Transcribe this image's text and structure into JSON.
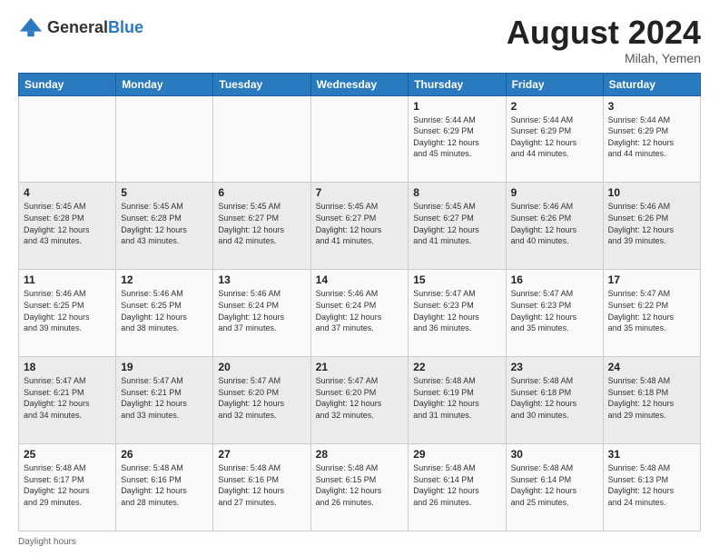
{
  "logo": {
    "general": "General",
    "blue": "Blue"
  },
  "title": {
    "month_year": "August 2024",
    "location": "Milah, Yemen"
  },
  "days_of_week": [
    "Sunday",
    "Monday",
    "Tuesday",
    "Wednesday",
    "Thursday",
    "Friday",
    "Saturday"
  ],
  "footer": {
    "label": "Daylight hours"
  },
  "weeks": [
    [
      {
        "day": "",
        "info": ""
      },
      {
        "day": "",
        "info": ""
      },
      {
        "day": "",
        "info": ""
      },
      {
        "day": "",
        "info": ""
      },
      {
        "day": "1",
        "info": "Sunrise: 5:44 AM\nSunset: 6:29 PM\nDaylight: 12 hours\nand 45 minutes."
      },
      {
        "day": "2",
        "info": "Sunrise: 5:44 AM\nSunset: 6:29 PM\nDaylight: 12 hours\nand 44 minutes."
      },
      {
        "day": "3",
        "info": "Sunrise: 5:44 AM\nSunset: 6:29 PM\nDaylight: 12 hours\nand 44 minutes."
      }
    ],
    [
      {
        "day": "4",
        "info": "Sunrise: 5:45 AM\nSunset: 6:28 PM\nDaylight: 12 hours\nand 43 minutes."
      },
      {
        "day": "5",
        "info": "Sunrise: 5:45 AM\nSunset: 6:28 PM\nDaylight: 12 hours\nand 43 minutes."
      },
      {
        "day": "6",
        "info": "Sunrise: 5:45 AM\nSunset: 6:27 PM\nDaylight: 12 hours\nand 42 minutes."
      },
      {
        "day": "7",
        "info": "Sunrise: 5:45 AM\nSunset: 6:27 PM\nDaylight: 12 hours\nand 41 minutes."
      },
      {
        "day": "8",
        "info": "Sunrise: 5:45 AM\nSunset: 6:27 PM\nDaylight: 12 hours\nand 41 minutes."
      },
      {
        "day": "9",
        "info": "Sunrise: 5:46 AM\nSunset: 6:26 PM\nDaylight: 12 hours\nand 40 minutes."
      },
      {
        "day": "10",
        "info": "Sunrise: 5:46 AM\nSunset: 6:26 PM\nDaylight: 12 hours\nand 39 minutes."
      }
    ],
    [
      {
        "day": "11",
        "info": "Sunrise: 5:46 AM\nSunset: 6:25 PM\nDaylight: 12 hours\nand 39 minutes."
      },
      {
        "day": "12",
        "info": "Sunrise: 5:46 AM\nSunset: 6:25 PM\nDaylight: 12 hours\nand 38 minutes."
      },
      {
        "day": "13",
        "info": "Sunrise: 5:46 AM\nSunset: 6:24 PM\nDaylight: 12 hours\nand 37 minutes."
      },
      {
        "day": "14",
        "info": "Sunrise: 5:46 AM\nSunset: 6:24 PM\nDaylight: 12 hours\nand 37 minutes."
      },
      {
        "day": "15",
        "info": "Sunrise: 5:47 AM\nSunset: 6:23 PM\nDaylight: 12 hours\nand 36 minutes."
      },
      {
        "day": "16",
        "info": "Sunrise: 5:47 AM\nSunset: 6:23 PM\nDaylight: 12 hours\nand 35 minutes."
      },
      {
        "day": "17",
        "info": "Sunrise: 5:47 AM\nSunset: 6:22 PM\nDaylight: 12 hours\nand 35 minutes."
      }
    ],
    [
      {
        "day": "18",
        "info": "Sunrise: 5:47 AM\nSunset: 6:21 PM\nDaylight: 12 hours\nand 34 minutes."
      },
      {
        "day": "19",
        "info": "Sunrise: 5:47 AM\nSunset: 6:21 PM\nDaylight: 12 hours\nand 33 minutes."
      },
      {
        "day": "20",
        "info": "Sunrise: 5:47 AM\nSunset: 6:20 PM\nDaylight: 12 hours\nand 32 minutes."
      },
      {
        "day": "21",
        "info": "Sunrise: 5:47 AM\nSunset: 6:20 PM\nDaylight: 12 hours\nand 32 minutes."
      },
      {
        "day": "22",
        "info": "Sunrise: 5:48 AM\nSunset: 6:19 PM\nDaylight: 12 hours\nand 31 minutes."
      },
      {
        "day": "23",
        "info": "Sunrise: 5:48 AM\nSunset: 6:18 PM\nDaylight: 12 hours\nand 30 minutes."
      },
      {
        "day": "24",
        "info": "Sunrise: 5:48 AM\nSunset: 6:18 PM\nDaylight: 12 hours\nand 29 minutes."
      }
    ],
    [
      {
        "day": "25",
        "info": "Sunrise: 5:48 AM\nSunset: 6:17 PM\nDaylight: 12 hours\nand 29 minutes."
      },
      {
        "day": "26",
        "info": "Sunrise: 5:48 AM\nSunset: 6:16 PM\nDaylight: 12 hours\nand 28 minutes."
      },
      {
        "day": "27",
        "info": "Sunrise: 5:48 AM\nSunset: 6:16 PM\nDaylight: 12 hours\nand 27 minutes."
      },
      {
        "day": "28",
        "info": "Sunrise: 5:48 AM\nSunset: 6:15 PM\nDaylight: 12 hours\nand 26 minutes."
      },
      {
        "day": "29",
        "info": "Sunrise: 5:48 AM\nSunset: 6:14 PM\nDaylight: 12 hours\nand 26 minutes."
      },
      {
        "day": "30",
        "info": "Sunrise: 5:48 AM\nSunset: 6:14 PM\nDaylight: 12 hours\nand 25 minutes."
      },
      {
        "day": "31",
        "info": "Sunrise: 5:48 AM\nSunset: 6:13 PM\nDaylight: 12 hours\nand 24 minutes."
      }
    ]
  ]
}
